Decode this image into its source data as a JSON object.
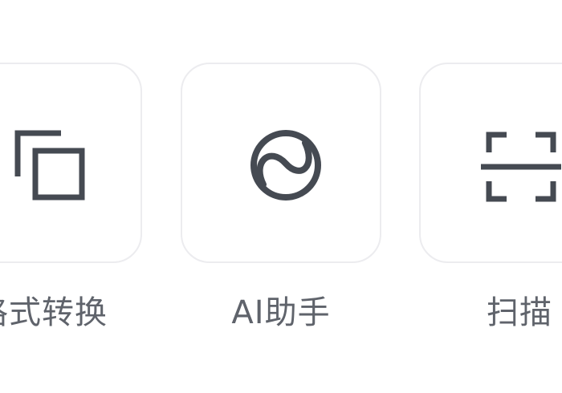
{
  "tools": [
    {
      "label": "格式转换",
      "icon": "overlapping-squares-icon"
    },
    {
      "label": "AI助手",
      "icon": "ai-ball-icon"
    },
    {
      "label": "扫描",
      "icon": "scan-frame-icon"
    }
  ],
  "colors": {
    "icon": "#454a52",
    "label": "#5f636b",
    "tile_border": "#ececef",
    "background": "#ffffff"
  }
}
